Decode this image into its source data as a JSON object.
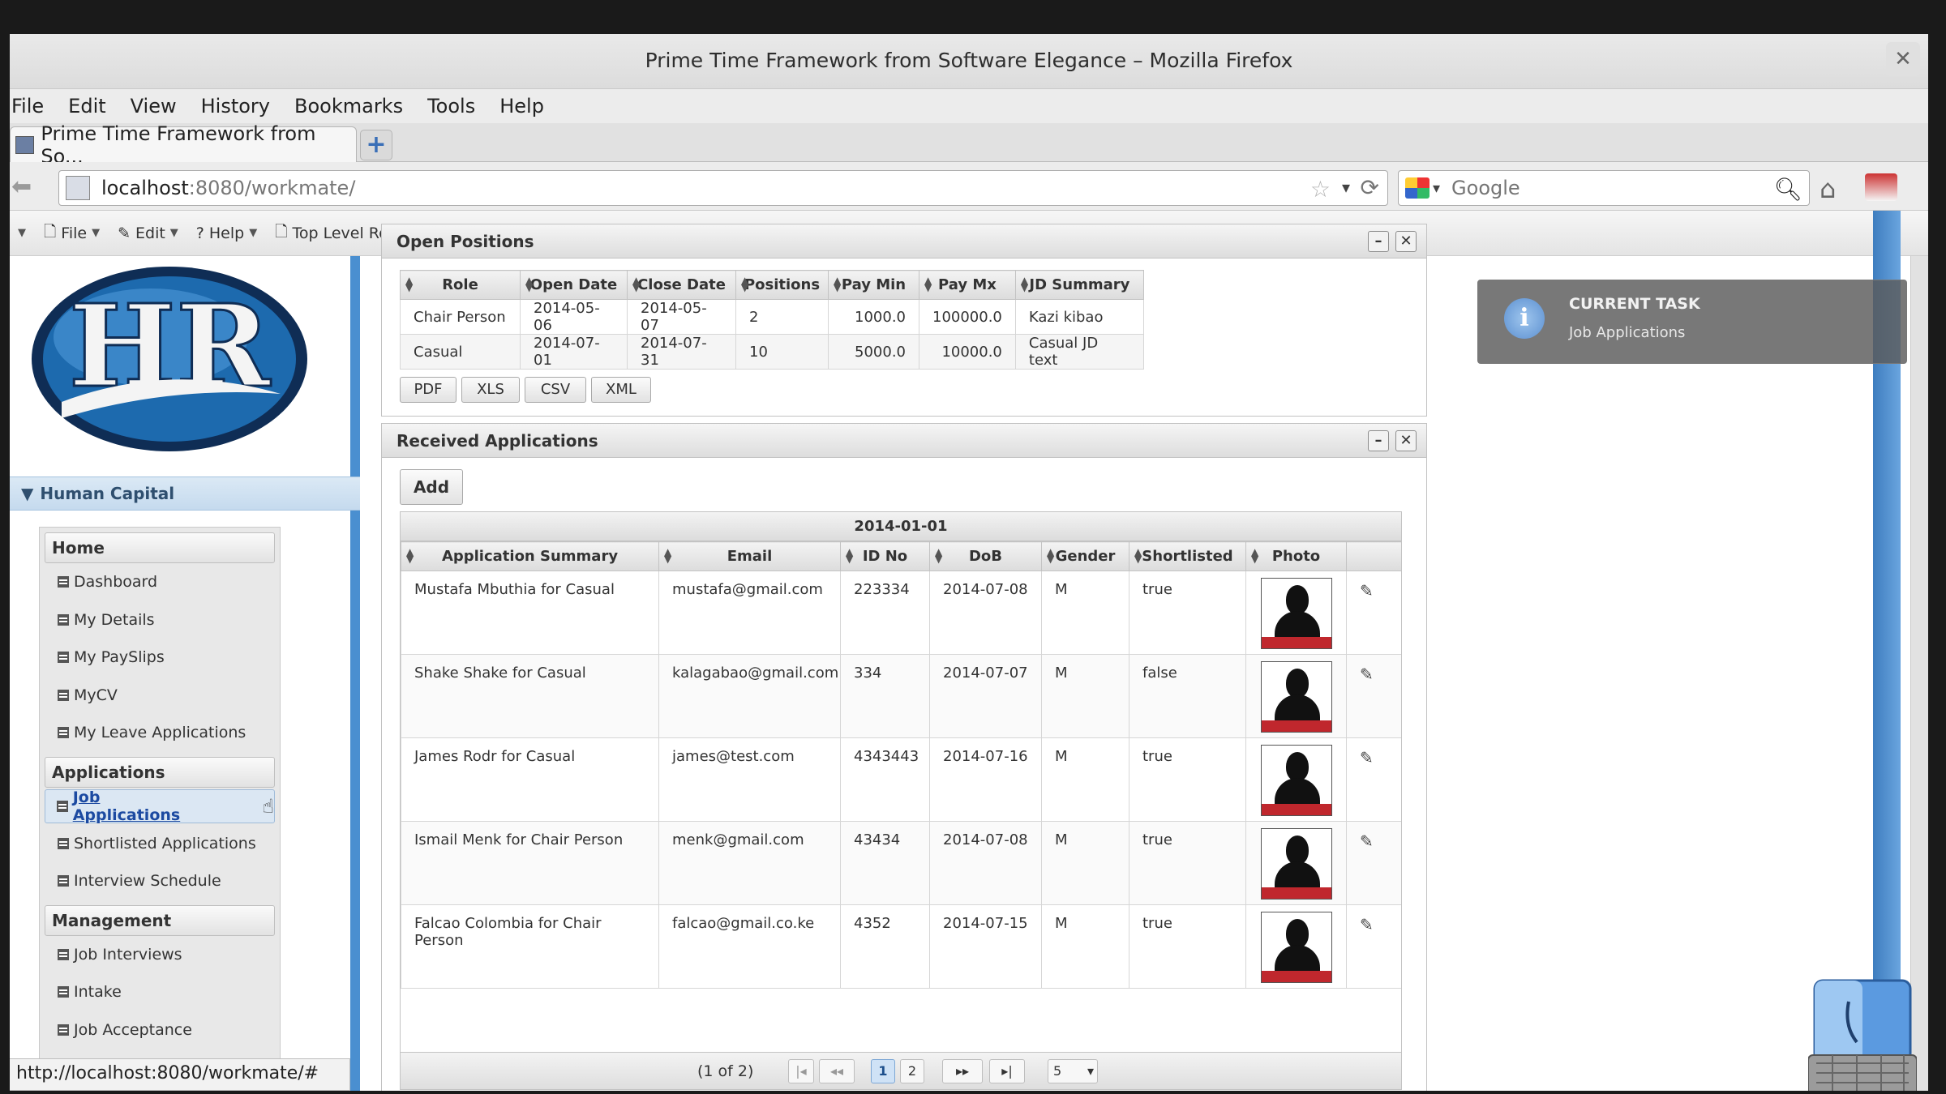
{
  "window": {
    "title": "Prime Time Framework from Software Elegance – Mozilla Firefox",
    "close_glyph": "✕"
  },
  "menubar": [
    "File",
    "Edit",
    "View",
    "History",
    "Bookmarks",
    "Tools",
    "Help"
  ],
  "tab": {
    "label": "Prime Time Framework from So...",
    "new_tab_glyph": "+"
  },
  "navbar": {
    "url_host": "localhost",
    "url_rest": ":8080/workmate/",
    "search_placeholder": "Google"
  },
  "appbar": {
    "items": [
      "File",
      "Edit",
      "Help",
      "Top Level Root Account"
    ]
  },
  "sidebar": {
    "section": "Human Capital",
    "groups": [
      {
        "label": "Home",
        "items": [
          "Dashboard",
          "My Details",
          "My PaySlips",
          "MyCV",
          "My Leave Applications"
        ]
      },
      {
        "label": "Applications",
        "items": [
          "Job Applications",
          "Shortlisted Applications",
          "Interview Schedule"
        ]
      },
      {
        "label": "Management",
        "items": [
          "Job Interviews",
          "Intake",
          "Job Acceptance"
        ]
      }
    ],
    "active_item": "Job Applications"
  },
  "open_positions": {
    "title": "Open Positions",
    "columns": [
      "Role",
      "Open Date",
      "Close Date",
      "Positions",
      "Pay Min",
      "Pay Mx",
      "JD Summary"
    ],
    "rows": [
      [
        "Chair Person",
        "2014-05-06",
        "2014-05-07",
        "2",
        "1000.0",
        "100000.0",
        "Kazi kibao"
      ],
      [
        "Casual",
        "2014-07-01",
        "2014-07-31",
        "10",
        "5000.0",
        "10000.0",
        "Casual JD text"
      ]
    ],
    "export_buttons": [
      "PDF",
      "XLS",
      "CSV",
      "XML"
    ]
  },
  "received_applications": {
    "title": "Received Applications",
    "add_label": "Add",
    "group_date": "2014-01-01",
    "columns": [
      "Application Summary",
      "Email",
      "ID No",
      "DoB",
      "Gender",
      "Shortlisted",
      "Photo"
    ],
    "rows": [
      [
        "Mustafa Mbuthia for Casual",
        "mustafa@gmail.com",
        "223334",
        "2014-07-08",
        "M",
        "true"
      ],
      [
        "Shake Shake for Casual",
        "kalagabao@gmail.com",
        "334",
        "2014-07-07",
        "M",
        "false"
      ],
      [
        "James Rodr for Casual",
        "james@test.com",
        "4343443",
        "2014-07-16",
        "M",
        "true"
      ],
      [
        "Ismail Menk for Chair Person",
        "menk@gmail.com",
        "43434",
        "2014-07-08",
        "M",
        "true"
      ],
      [
        "Falcao Colombia for Chair Person",
        "falcao@gmail.co.ke",
        "4352",
        "2014-07-15",
        "M",
        "true"
      ]
    ],
    "paginator": {
      "report": "(1 of 2)",
      "pages": [
        "1",
        "2"
      ],
      "rows_per_page": "5"
    }
  },
  "notification": {
    "title": "CURRENT TASK",
    "message": "Job Applications"
  },
  "status_url": "http://localhost:8080/workmate/#",
  "colors": {
    "accent_blue": "#4a8fd0",
    "link_active": "#1c4aa1",
    "photo_band": "#c0272d"
  }
}
